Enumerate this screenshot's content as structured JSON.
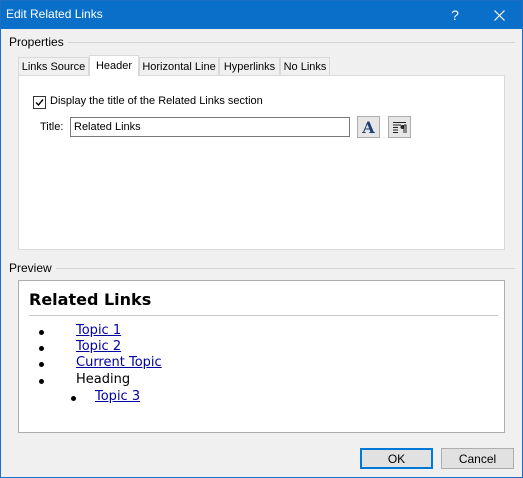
{
  "window": {
    "title": "Edit Related Links",
    "help_label": "?"
  },
  "properties": {
    "label": "Properties",
    "tabs": [
      {
        "label": "Links Source"
      },
      {
        "label": "Header"
      },
      {
        "label": "Horizontal Line"
      },
      {
        "label": "Hyperlinks"
      },
      {
        "label": "No Links"
      }
    ],
    "active_tab": "Header",
    "display_title_checkbox": {
      "label": "Display the title of the Related Links section",
      "checked": true
    },
    "title_field": {
      "label": "Title:",
      "value": "Related Links"
    },
    "font_button_glyph": "A"
  },
  "preview": {
    "label": "Preview",
    "heading": "Related Links",
    "items": [
      {
        "text": "Topic 1",
        "link": true
      },
      {
        "text": "Topic 2",
        "link": true
      },
      {
        "text": "Current Topic",
        "link": true
      },
      {
        "text": "Heading",
        "link": false
      },
      {
        "text": "Topic 3",
        "link": true
      }
    ]
  },
  "buttons": {
    "ok": "OK",
    "cancel": "Cancel"
  },
  "colors": {
    "titlebar": "#0a6fc9",
    "link": "#0000a0",
    "default_button_border": "#0078d7"
  }
}
